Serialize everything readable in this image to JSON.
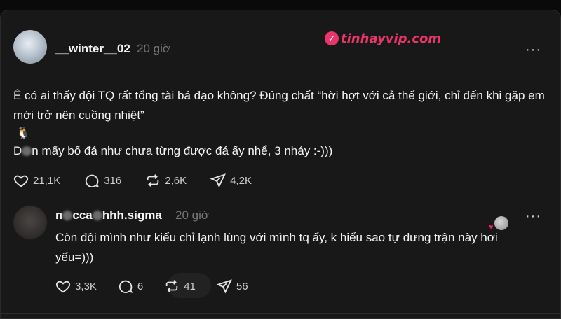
{
  "brand": {
    "name": "tinhayvip.com"
  },
  "post1": {
    "username": "__winter__02",
    "time": "20 giờ",
    "text_line1": "Ê có ai thấy đội TQ rất tổng tài bá đạo không? Đúng chất “hời hợt với cả thế giới, chỉ đến khi gặp em mới trở nên cuồng nhiệt”",
    "text_line2_a": "D",
    "text_line2_b": "n mấy bố đá như chưa từng được đá ấy nhể, 3 nháy :-)))",
    "likes": "21,1K",
    "comments": "316",
    "reposts": "2,6K",
    "shares": "4,2K"
  },
  "post2": {
    "username_a": "n",
    "username_b": "cca",
    "username_c": "hhh.sigma",
    "time": "20 giờ",
    "text": "Còn đội mình như kiểu chỉ lạnh lùng với mình tq ấy, k hiểu sao tự dưng trận này hơi yếu=)))",
    "likes": "3,3K",
    "comments": "6",
    "reposts": "41",
    "shares": "56"
  }
}
